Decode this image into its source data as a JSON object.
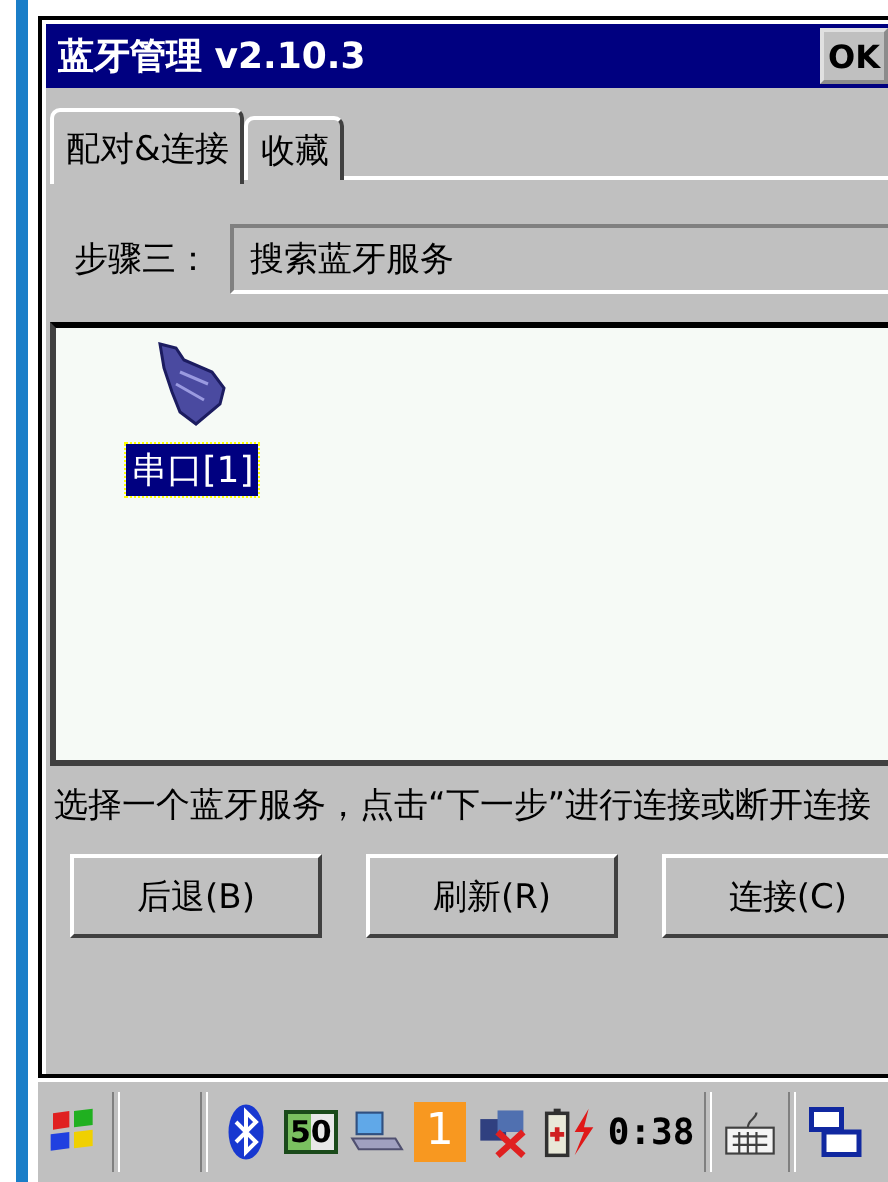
{
  "window": {
    "title": "蓝牙管理 v2.10.3",
    "ok_button": "OK"
  },
  "tabs": [
    {
      "label": "配对&连接",
      "selected": true
    },
    {
      "label": "收藏",
      "selected": false
    }
  ],
  "step": {
    "label": "步骤三：",
    "value": "搜索蓝牙服务"
  },
  "services": [
    {
      "label": "串口[1]",
      "selected": true
    }
  ],
  "hint": "选择一个蓝牙服务，点击“下一步”进行连接或断开连接",
  "buttons": [
    "后退(B)",
    "刷新(R)",
    "连接(C)"
  ],
  "taskbar": {
    "signal_badge": "50",
    "count_badge": "1",
    "clock": "0:38"
  }
}
